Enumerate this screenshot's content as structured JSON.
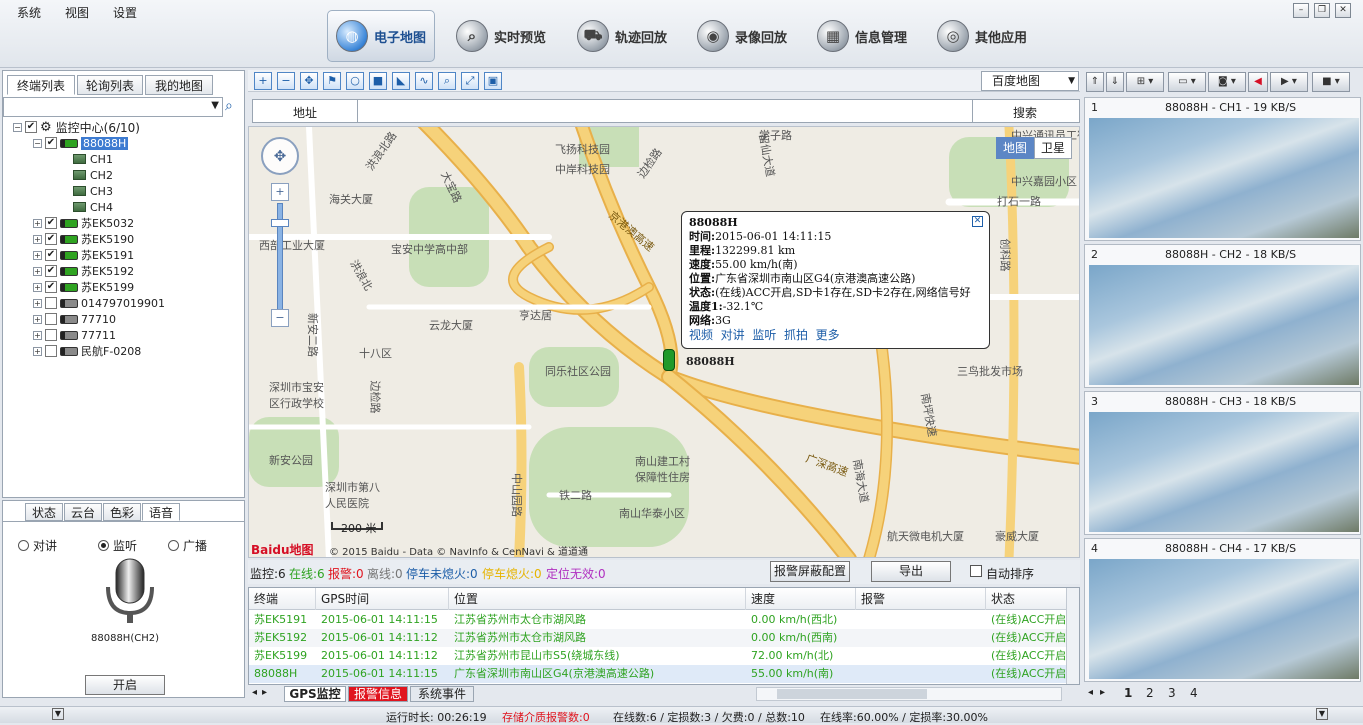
{
  "menu": [
    "系统",
    "视图",
    "设置"
  ],
  "nav": [
    {
      "label": "电子地图",
      "icon": "globe-icon",
      "active": true
    },
    {
      "label": "实时预览",
      "icon": "preview-icon"
    },
    {
      "label": "轨迹回放",
      "icon": "track-icon"
    },
    {
      "label": "录像回放",
      "icon": "video-replay-icon"
    },
    {
      "label": "信息管理",
      "icon": "info-manage-icon"
    },
    {
      "label": "其他应用",
      "icon": "apps-icon"
    }
  ],
  "left_tabs": [
    "终端列表",
    "轮询列表",
    "我的地图"
  ],
  "tree": {
    "root": "监控中心(6/10)",
    "selected": "88088H",
    "channels": [
      "CH1",
      "CH2",
      "CH3",
      "CH4"
    ],
    "vehicles": [
      {
        "name": "苏EK5032",
        "online": true,
        "checked": true
      },
      {
        "name": "苏EK5190",
        "online": true,
        "checked": true
      },
      {
        "name": "苏EK5191",
        "online": true,
        "checked": true
      },
      {
        "name": "苏EK5192",
        "online": true,
        "checked": true
      },
      {
        "name": "苏EK5199",
        "online": true,
        "checked": true
      },
      {
        "name": "014797019901",
        "online": false,
        "checked": false
      },
      {
        "name": "77710",
        "online": false,
        "checked": false
      },
      {
        "name": "77711",
        "online": false,
        "checked": false
      },
      {
        "name": "民航F-0208",
        "online": false,
        "checked": false
      }
    ]
  },
  "bottom_tabs": [
    "状态",
    "云台",
    "色彩",
    "语音"
  ],
  "voice": {
    "options": [
      "对讲",
      "监听",
      "广播"
    ],
    "selected": "监听",
    "device": "88088H(CH2)",
    "open_button": "开启"
  },
  "map": {
    "provider": "百度地图",
    "addr_label": "地址",
    "search_label": "搜索",
    "mode_map": "地图",
    "mode_sat": "卫星",
    "scale": "200 米",
    "copyright": "© 2015 Baidu - Data © NavInfo & CenNavi & 道道通",
    "logo": "Baidu地图",
    "vehicle_label": "88088H",
    "places": [
      {
        "t": "飞扬科技园"
      },
      {
        "t": "中岸科技园"
      },
      {
        "t": "边检路"
      },
      {
        "t": "洪浪北路"
      },
      {
        "t": "海关大厦"
      },
      {
        "t": "大宝路"
      },
      {
        "t": "京港澳高速"
      },
      {
        "t": "西部工业大厦"
      },
      {
        "t": "宝安中学高中部"
      },
      {
        "t": "洪浪北"
      },
      {
        "t": "云龙大厦"
      },
      {
        "t": "亨达居"
      },
      {
        "t": "十八区"
      },
      {
        "t": "深圳市宝安区行政学校"
      },
      {
        "t": "同乐社区公园"
      },
      {
        "t": "新安公园"
      },
      {
        "t": "深圳市第八人民医院"
      },
      {
        "t": "南山建工村保障性住房"
      },
      {
        "t": "铁二路"
      },
      {
        "t": "南山华泰小区"
      },
      {
        "t": "航天微电机大厦"
      },
      {
        "t": "豪威大厦"
      },
      {
        "t": "三鸟批发市场"
      },
      {
        "t": "打石一路"
      },
      {
        "t": "中兴嘉园小区"
      },
      {
        "t": "中兴通讯员工宿舍"
      },
      {
        "t": "留仙大道"
      },
      {
        "t": "创科路"
      },
      {
        "t": "南坪快速"
      },
      {
        "t": "广深高速"
      },
      {
        "t": "南海大道"
      },
      {
        "t": "中山园路"
      },
      {
        "t": "新安二路"
      },
      {
        "t": "边检路"
      },
      {
        "t": "学子路"
      }
    ]
  },
  "popup": {
    "title": "88088H",
    "rows": [
      {
        "k": "时间:",
        "v": "2015-06-01 14:11:15"
      },
      {
        "k": "里程:",
        "v": "132299.81 km"
      },
      {
        "k": "速度:",
        "v": "55.00 km/h(南)"
      },
      {
        "k": "位置:",
        "v": "广东省深圳市南山区G4(京港澳高速公路)"
      },
      {
        "k": "状态:",
        "v": "(在线)ACC开启,SD卡1存在,SD卡2存在,网络信号好"
      },
      {
        "k": "温度1:",
        "v": "-32.1℃"
      },
      {
        "k": "网络:",
        "v": "3G"
      }
    ],
    "links": [
      "视频",
      "对讲",
      "监听",
      "抓拍",
      "更多"
    ]
  },
  "stats": {
    "monitor": "监控:6",
    "online": "在线:6",
    "alarm": "报警:0",
    "offline": "离线:0",
    "stop_off": "停车未熄火:0",
    "stop_on": "停车熄火:0",
    "loc_invalid": "定位无效:0",
    "alarm_btn": "报警屏蔽配置",
    "export_btn": "导出",
    "auto_sort": "自动排序"
  },
  "table": {
    "headers": [
      "终端",
      "GPS时间",
      "位置",
      "速度",
      "报警",
      "状态"
    ],
    "rows": [
      {
        "c": [
          "苏EK5191",
          "2015-06-01 14:11:15",
          "江苏省苏州市太仓市湖风路",
          "0.00 km/h(西北)",
          "",
          "(在线)ACC开启"
        ]
      },
      {
        "c": [
          "苏EK5192",
          "2015-06-01 14:11:12",
          "江苏省苏州市太仓市湖风路",
          "0.00 km/h(西南)",
          "",
          "(在线)ACC开启"
        ]
      },
      {
        "c": [
          "苏EK5199",
          "2015-06-01 14:11:12",
          "江苏省苏州市昆山市S5(绕城东线)",
          "72.00 km/h(北)",
          "",
          "(在线)ACC开启"
        ]
      },
      {
        "c": [
          "88088H",
          "2015-06-01 14:11:15",
          "广东省深圳市南山区G4(京港澳高速公路)",
          "55.00 km/h(南)",
          "",
          "(在线)ACC开启"
        ]
      }
    ]
  },
  "bottom_map_tabs": [
    "GPS监控",
    "报警信息",
    "系统事件"
  ],
  "videos": [
    {
      "n": "1",
      "title": "88088H - CH1 - 19 KB/S"
    },
    {
      "n": "2",
      "title": "88088H - CH2 - 18 KB/S"
    },
    {
      "n": "3",
      "title": "88088H - CH3 - 18 KB/S"
    },
    {
      "n": "4",
      "title": "88088H - CH4 - 17 KB/S"
    }
  ],
  "video_pages": [
    "1",
    "2",
    "3",
    "4"
  ],
  "footer": {
    "runtime": "运行时长: 00:26:19",
    "storage": "存储介质报警数:0",
    "counts": "在线数:6 / 定损数:3 / 欠费:0 / 总数:10",
    "rates": "在线率:60.00% / 定损率:30.00%"
  },
  "colors": {
    "online": "#2fa321",
    "alarm": "#e0141e",
    "link": "#1d5ea8",
    "yellow": "#e6b400",
    "purple": "#b030c0"
  }
}
